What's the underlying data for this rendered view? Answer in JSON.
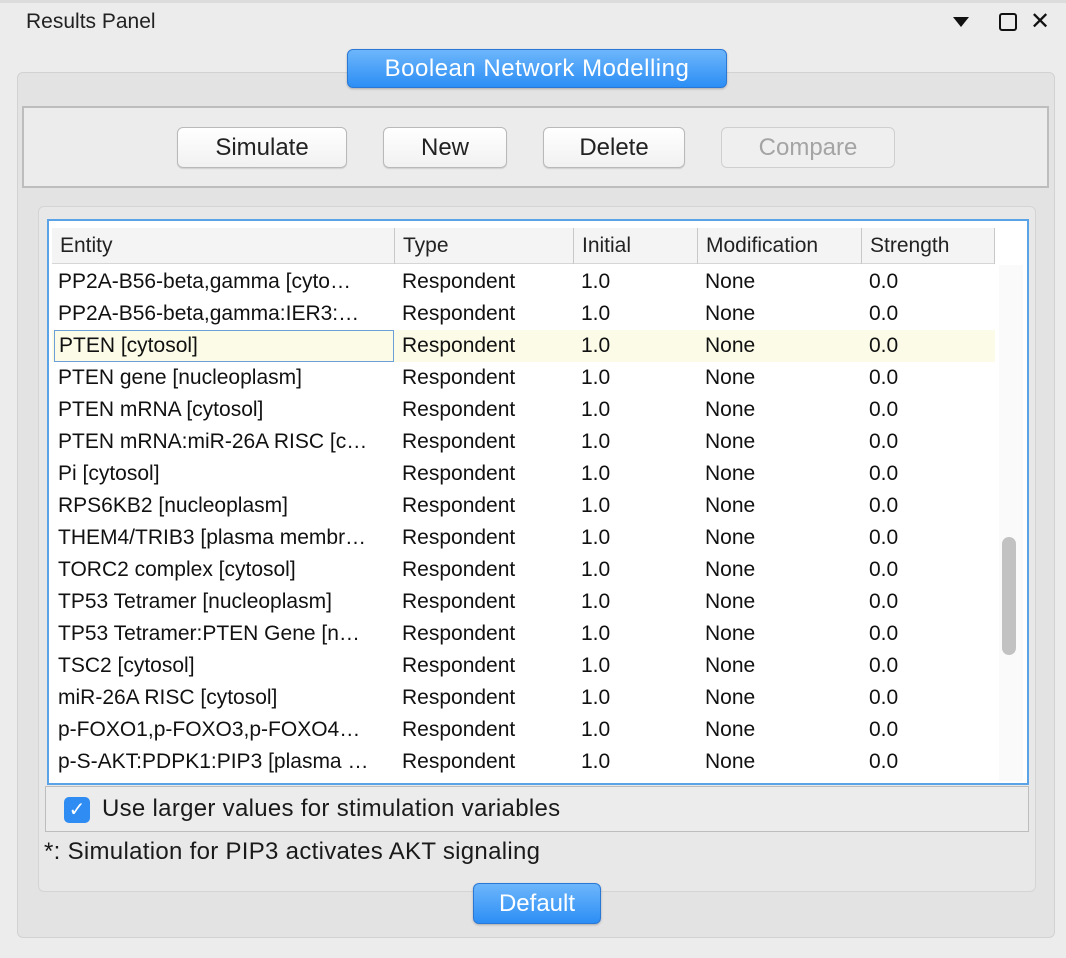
{
  "panel": {
    "title": "Results Panel"
  },
  "tab": {
    "label": "Boolean Network Modelling"
  },
  "toolbar": {
    "simulate": "Simulate",
    "new": "New",
    "delete": "Delete",
    "compare": "Compare"
  },
  "table": {
    "columns": [
      "Entity",
      "Type",
      "Initial",
      "Modification",
      "Strength"
    ],
    "selected_row": 2,
    "rows": [
      [
        "PP2A-B56-beta,gamma [cyto…",
        "Respondent",
        "1.0",
        "None",
        "0.0"
      ],
      [
        "PP2A-B56-beta,gamma:IER3:…",
        "Respondent",
        "1.0",
        "None",
        "0.0"
      ],
      [
        "PTEN [cytosol]",
        "Respondent",
        "1.0",
        "None",
        "0.0"
      ],
      [
        "PTEN gene [nucleoplasm]",
        "Respondent",
        "1.0",
        "None",
        "0.0"
      ],
      [
        "PTEN mRNA [cytosol]",
        "Respondent",
        "1.0",
        "None",
        "0.0"
      ],
      [
        "PTEN mRNA:miR-26A RISC [c…",
        "Respondent",
        "1.0",
        "None",
        "0.0"
      ],
      [
        "Pi [cytosol]",
        "Respondent",
        "1.0",
        "None",
        "0.0"
      ],
      [
        "RPS6KB2 [nucleoplasm]",
        "Respondent",
        "1.0",
        "None",
        "0.0"
      ],
      [
        "THEM4/TRIB3 [plasma membr…",
        "Respondent",
        "1.0",
        "None",
        "0.0"
      ],
      [
        "TORC2 complex [cytosol]",
        "Respondent",
        "1.0",
        "None",
        "0.0"
      ],
      [
        "TP53 Tetramer [nucleoplasm]",
        "Respondent",
        "1.0",
        "None",
        "0.0"
      ],
      [
        "TP53 Tetramer:PTEN Gene [n…",
        "Respondent",
        "1.0",
        "None",
        "0.0"
      ],
      [
        "TSC2 [cytosol]",
        "Respondent",
        "1.0",
        "None",
        "0.0"
      ],
      [
        "miR-26A RISC [cytosol]",
        "Respondent",
        "1.0",
        "None",
        "0.0"
      ],
      [
        "p-FOXO1,p-FOXO3,p-FOXO4…",
        "Respondent",
        "1.0",
        "None",
        "0.0"
      ],
      [
        "p-S-AKT:PDPK1:PIP3 [plasma …",
        "Respondent",
        "1.0",
        "None",
        "0.0"
      ]
    ]
  },
  "options": {
    "larger_values_label": "Use larger values for stimulation variables",
    "larger_values_checked": true
  },
  "note": "*: Simulation for PIP3 activates AKT signaling",
  "footer": {
    "default_label": "Default"
  },
  "colors": {
    "accent": "#2f8cf3",
    "selected_row": "#fbfbe7",
    "table_border": "#5aa3e6"
  }
}
